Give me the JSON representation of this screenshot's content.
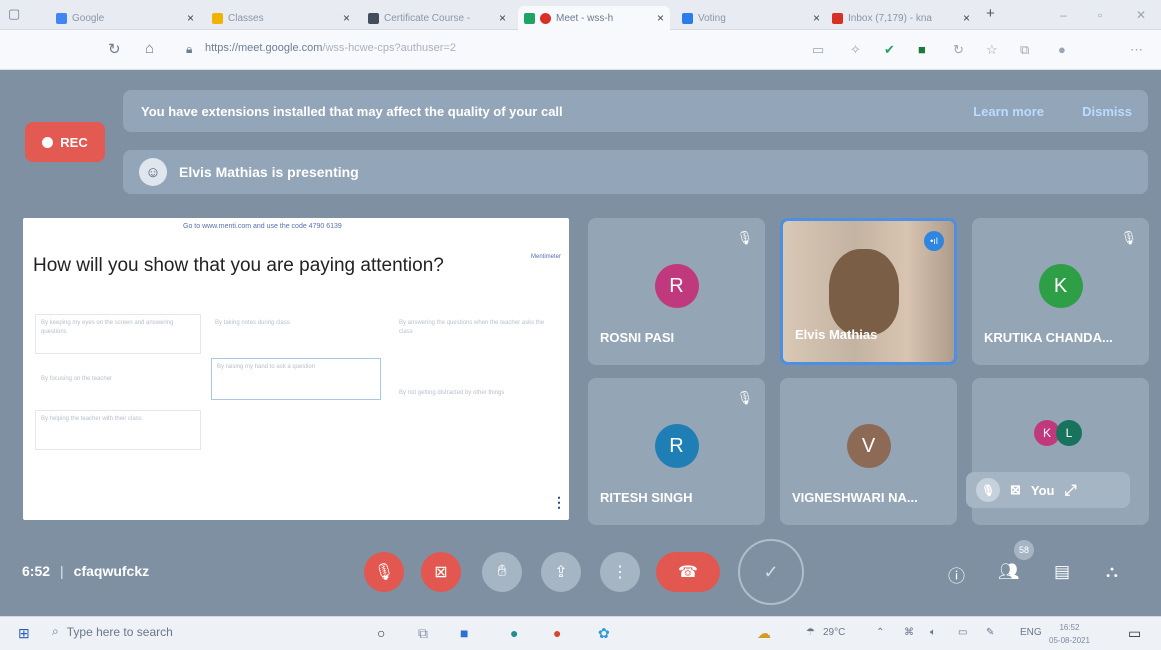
{
  "browser": {
    "tabs": [
      {
        "label": "Google",
        "color": "#4285f4"
      },
      {
        "label": "Classes",
        "color": "#f0b400"
      },
      {
        "label": "Certificate Course -",
        "color": "#444d5c"
      },
      {
        "label": "Meet - wss-h",
        "color": "#1fa463"
      },
      {
        "label": "Voting",
        "color": "#2b7de9"
      },
      {
        "label": "Inbox (7,179) - kna",
        "color": "#d93025"
      }
    ],
    "new_tab": "+",
    "url_host": "https://meet.google.com",
    "url_path": "/wss-hcwe-cps?authuser=2"
  },
  "meet": {
    "banner_text": "You have extensions installed that may affect the quality of your call",
    "learn_more": "Learn more",
    "dismiss": "Dismiss",
    "rec_label": "REC",
    "presenting_text": "Elvis Mathias is presenting",
    "slide": {
      "code_line": "Go to www.menti.com and use the code 4790 6139",
      "brand": "Mentimeter",
      "question": "How will you show that you are paying attention?",
      "options": [
        "By keeping my eyes on the screen and answering questions",
        "By taking notes during class",
        "By answering the questions when the teacher asks the class",
        "By focusing on the teacher",
        "By raising my hand to ask a question",
        "By not getting distracted by other things",
        "By helping the teacher with their class"
      ]
    },
    "participants": [
      {
        "name": "ROSNI PASI",
        "initial": "R",
        "color": "#c0397e",
        "muted": true
      },
      {
        "name": "Elvis Mathias",
        "video": true,
        "speaking": true
      },
      {
        "name": "KRUTIKA CHANDA...",
        "initial": "K",
        "color": "#2e9e47",
        "muted": true
      },
      {
        "name": "RITESH SINGH",
        "initial": "R",
        "color": "#1f7fb4",
        "muted": true
      },
      {
        "name": "VIGNESHWARI NA...",
        "initial": "V",
        "color": "#8d6a55",
        "muted": false
      }
    ],
    "others": [
      {
        "initial": "K",
        "color": "#c0397e"
      },
      {
        "initial": "L",
        "color": "#17735c"
      }
    ],
    "self_label": "You",
    "time": "6:52",
    "meeting_code": "cfaqwufckz",
    "participant_count": "58"
  },
  "taskbar": {
    "search_placeholder": "Type here to search",
    "temperature": "29°C",
    "lang": "ENG",
    "time": "16:52",
    "date": "05-08-2021"
  }
}
